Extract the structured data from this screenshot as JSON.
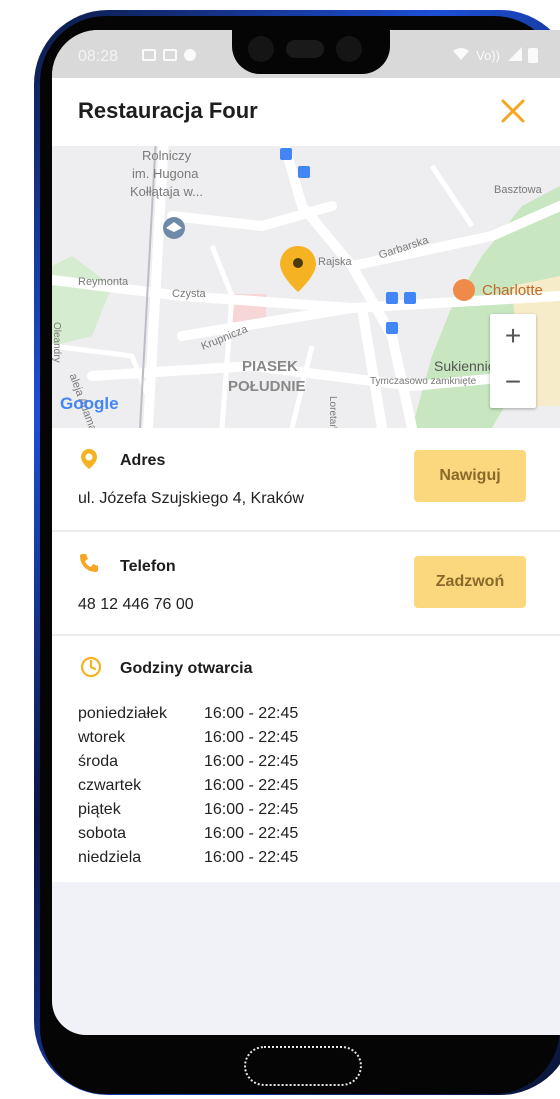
{
  "status": {
    "time": "08:28",
    "network": "Vo))",
    "colors": {
      "bar": "#d9d9d9"
    }
  },
  "header": {
    "title": "Restauracja Four",
    "close_icon": "close-icon",
    "accent": "#f5a623"
  },
  "map": {
    "labels": {
      "rolniczy": "Rolniczy",
      "hugona": "im. Hugona",
      "kollataja": "Kołłątaja w...",
      "basztowa": "Basztowa",
      "rajska": "Rajska",
      "garbarska": "Garbarska",
      "reymonta": "Reymonta",
      "czysta": "Czysta",
      "charlotte": "Charlotte",
      "krupnicza": "Krupnicza",
      "mickiewicza": "aleja Adama Mickiewicza",
      "oleandry": "Oleandry",
      "piasek": "PIASEK",
      "poludnie": "POŁUDNIE",
      "loretanska": "Loretańska",
      "sukiennice": "Sukiennice",
      "tymczasowo": "Tymczasowo zamknięte",
      "google": "Google"
    },
    "zoom_in": "+",
    "zoom_out": "−"
  },
  "address": {
    "label": "Adres",
    "value": "ul. Józefa Szujskiego 4, Kraków",
    "button": "Nawiguj"
  },
  "phone": {
    "label": "Telefon",
    "value": "48 12 446 76 00",
    "button": "Zadzwoń"
  },
  "hours": {
    "label": "Godziny otwarcia",
    "rows": [
      {
        "day": "poniedziałek",
        "time": "16:00 - 22:45"
      },
      {
        "day": "wtorek",
        "time": "16:00 - 22:45"
      },
      {
        "day": "środa",
        "time": "16:00 - 22:45"
      },
      {
        "day": "czwartek",
        "time": "16:00 - 22:45"
      },
      {
        "day": "piątek",
        "time": "16:00 - 22:45"
      },
      {
        "day": "sobota",
        "time": "16:00 - 22:45"
      },
      {
        "day": "niedziela",
        "time": "16:00 - 22:45"
      }
    ]
  }
}
